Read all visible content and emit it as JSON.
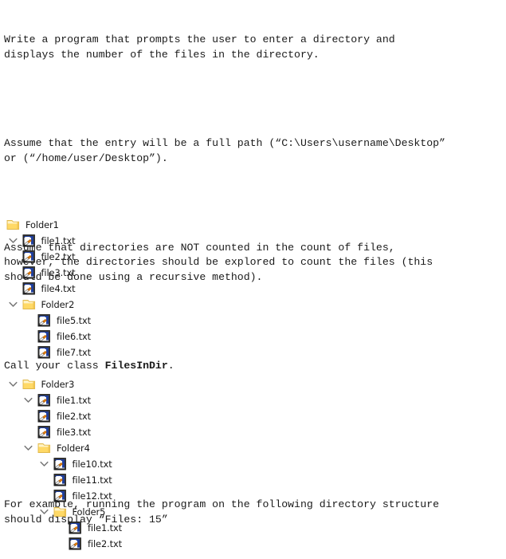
{
  "assignment": {
    "para1": "Write a program that prompts the user to enter a directory and\ndisplays the number of the files in the directory.",
    "para2": "Assume that the entry will be a full path (“C:\\Users\\username\\Desktop”\nor (“/home/user/Desktop”).",
    "para3": "Assume that directories are NOT counted in the count of files,\nhowever, the directories should be explored to count the files (this\nshould be done using a recursive method).",
    "para4_prefix": "Call your class ",
    "para4_class": "FilesInDir",
    "para4_suffix": ".",
    "para5": "For example, running the program on the following directory structure\nshould display “Files: 15”"
  },
  "tree": {
    "rows": [
      {
        "label": "Folder1",
        "type": "folder",
        "depth": 0,
        "chevron": false
      },
      {
        "label": "file1.txt",
        "type": "file",
        "depth": 1,
        "chevron": true
      },
      {
        "label": "file2.txt",
        "type": "file",
        "depth": 1,
        "chevron": false
      },
      {
        "label": "file3.txt",
        "type": "file",
        "depth": 1,
        "chevron": false
      },
      {
        "label": "file4.txt",
        "type": "file",
        "depth": 1,
        "chevron": false
      },
      {
        "label": "Folder2",
        "type": "folder",
        "depth": 1,
        "chevron": true
      },
      {
        "label": "file5.txt",
        "type": "file",
        "depth": 2,
        "chevron": false
      },
      {
        "label": "file6.txt",
        "type": "file",
        "depth": 2,
        "chevron": false
      },
      {
        "label": "file7.txt",
        "type": "file",
        "depth": 2,
        "chevron": false
      },
      {
        "label": "",
        "type": "spacer",
        "depth": 0,
        "chevron": false
      },
      {
        "label": "Folder3",
        "type": "folder",
        "depth": 1,
        "chevron": true
      },
      {
        "label": "file1.txt",
        "type": "file",
        "depth": 2,
        "chevron": true
      },
      {
        "label": "file2.txt",
        "type": "file",
        "depth": 2,
        "chevron": false
      },
      {
        "label": "file3.txt",
        "type": "file",
        "depth": 2,
        "chevron": false
      },
      {
        "label": "Folder4",
        "type": "folder",
        "depth": 2,
        "chevron": true
      },
      {
        "label": "file10.txt",
        "type": "file",
        "depth": 3,
        "chevron": true
      },
      {
        "label": "file11.txt",
        "type": "file",
        "depth": 3,
        "chevron": false
      },
      {
        "label": "file12.txt",
        "type": "file",
        "depth": 3,
        "chevron": false
      },
      {
        "label": "Folder5",
        "type": "folder",
        "depth": 3,
        "chevron": true
      },
      {
        "label": "file1.txt",
        "type": "file",
        "depth": 4,
        "chevron": false
      },
      {
        "label": "file2.txt",
        "type": "file",
        "depth": 4,
        "chevron": false
      }
    ]
  },
  "colors": {
    "folder_fill": "#ffd966",
    "folder_light": "#fff4c9",
    "file_page": "#ffffff",
    "file_blue": "#1f3f9e",
    "chevron": "#767676",
    "text": "#161616"
  }
}
